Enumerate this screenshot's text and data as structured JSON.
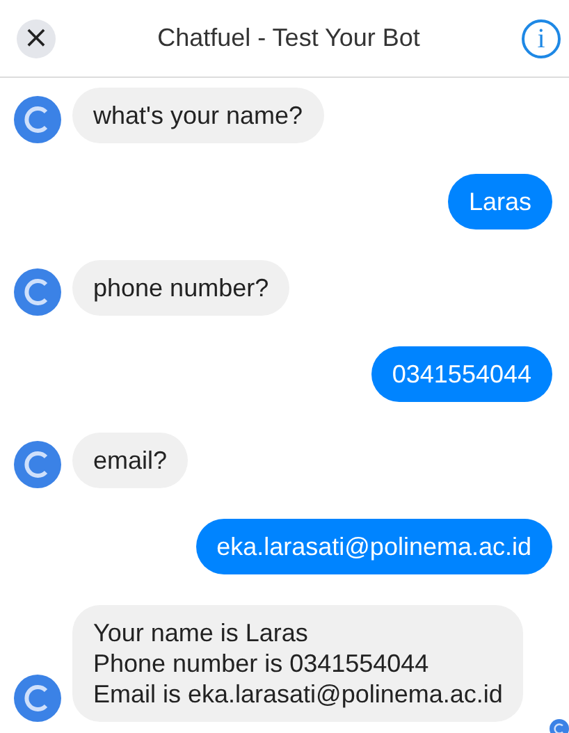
{
  "header": {
    "close": "×",
    "title": "Chatfuel - Test Your Bot",
    "info": "i"
  },
  "messages": [
    {
      "kind": "bot",
      "lines": [
        "what's your name?"
      ]
    },
    {
      "kind": "user",
      "lines": [
        "Laras"
      ]
    },
    {
      "kind": "bot",
      "lines": [
        "phone number?"
      ]
    },
    {
      "kind": "user",
      "lines": [
        "0341554044"
      ]
    },
    {
      "kind": "bot",
      "lines": [
        "email?"
      ]
    },
    {
      "kind": "user",
      "lines": [
        "eka.larasati@polinema.ac.id"
      ]
    },
    {
      "kind": "bot",
      "lines": [
        "Your name is Laras",
        "Phone number is 0341554044",
        "Email is eka.larasati@polinema.ac.id"
      ],
      "seen": true
    }
  ]
}
